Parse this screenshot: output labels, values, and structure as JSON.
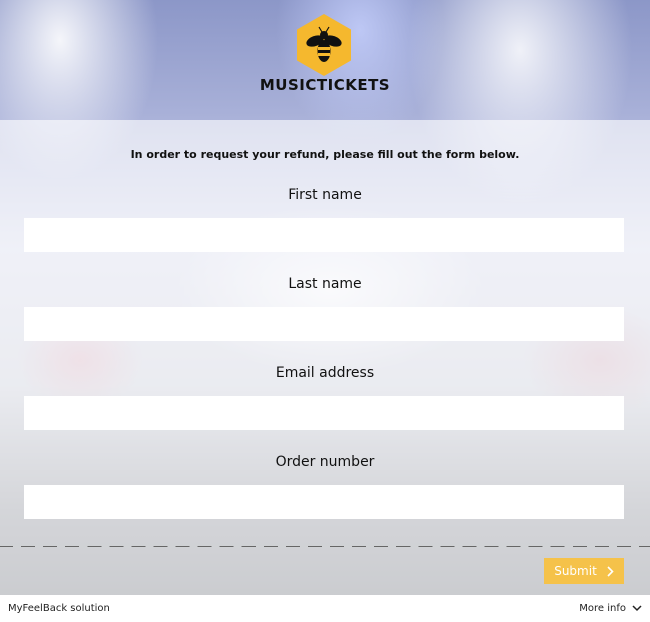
{
  "brand": {
    "name": "MUSICTICKETS",
    "accent_color": "#f5c24a"
  },
  "form": {
    "intro": "In order to request your refund, please fill out the form below.",
    "fields": [
      {
        "label": "First name",
        "value": "",
        "placeholder": ""
      },
      {
        "label": "Last name",
        "value": "",
        "placeholder": ""
      },
      {
        "label": "Email address",
        "value": "",
        "placeholder": ""
      },
      {
        "label": "Order number",
        "value": "",
        "placeholder": ""
      }
    ],
    "submit_label": "Submit",
    "submit_icon": "chevron-right-icon"
  },
  "footer": {
    "left_text": "MyFeelBack solution",
    "right_text": "More info",
    "right_icon": "chevron-down-icon"
  }
}
